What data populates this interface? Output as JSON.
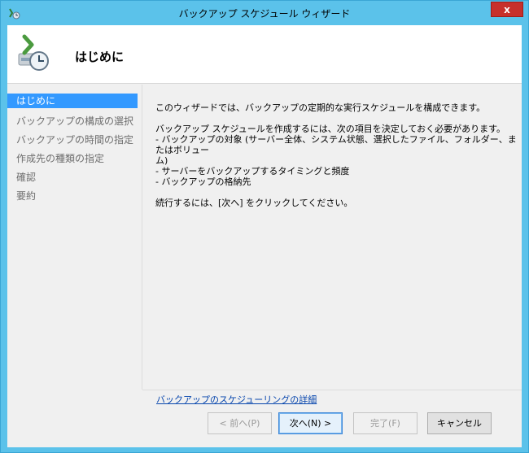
{
  "window": {
    "title": "バックアップ スケジュール ウィザード",
    "close_label": "x"
  },
  "header": {
    "title": "はじめに"
  },
  "nav": {
    "items": [
      {
        "label": "はじめに",
        "active": true
      },
      {
        "label": "バックアップの構成の選択",
        "active": false
      },
      {
        "label": "バックアップの時間の指定",
        "active": false
      },
      {
        "label": "作成先の種類の指定",
        "active": false
      },
      {
        "label": "確認",
        "active": false
      },
      {
        "label": "要約",
        "active": false
      }
    ]
  },
  "content": {
    "intro": "このウィザードでは、バックアップの定期的な実行スケジュールを構成できます。",
    "decide_heading": "バックアップ スケジュールを作成するには、次の項目を決定しておく必要があります。",
    "bullet1a": "- バックアップの対象 (サーバー全体、システム状態、選択したファイル、フォルダー、またはボリュー",
    "bullet1b": "ム)",
    "bullet2": "- サーバーをバックアップするタイミングと頻度",
    "bullet3": "- バックアップの格納先",
    "continue_text": "続行するには、[次へ] をクリックしてください。",
    "link": "バックアップのスケジューリングの詳細"
  },
  "buttons": {
    "back": "< 前へ(P)",
    "next": "次へ(N) >",
    "finish": "完了(F)",
    "cancel": "キャンセル"
  },
  "colors": {
    "titlebar": "#5bc2ea",
    "close": "#c7302b",
    "nav_active": "#3399ff",
    "link": "#0645ad"
  }
}
